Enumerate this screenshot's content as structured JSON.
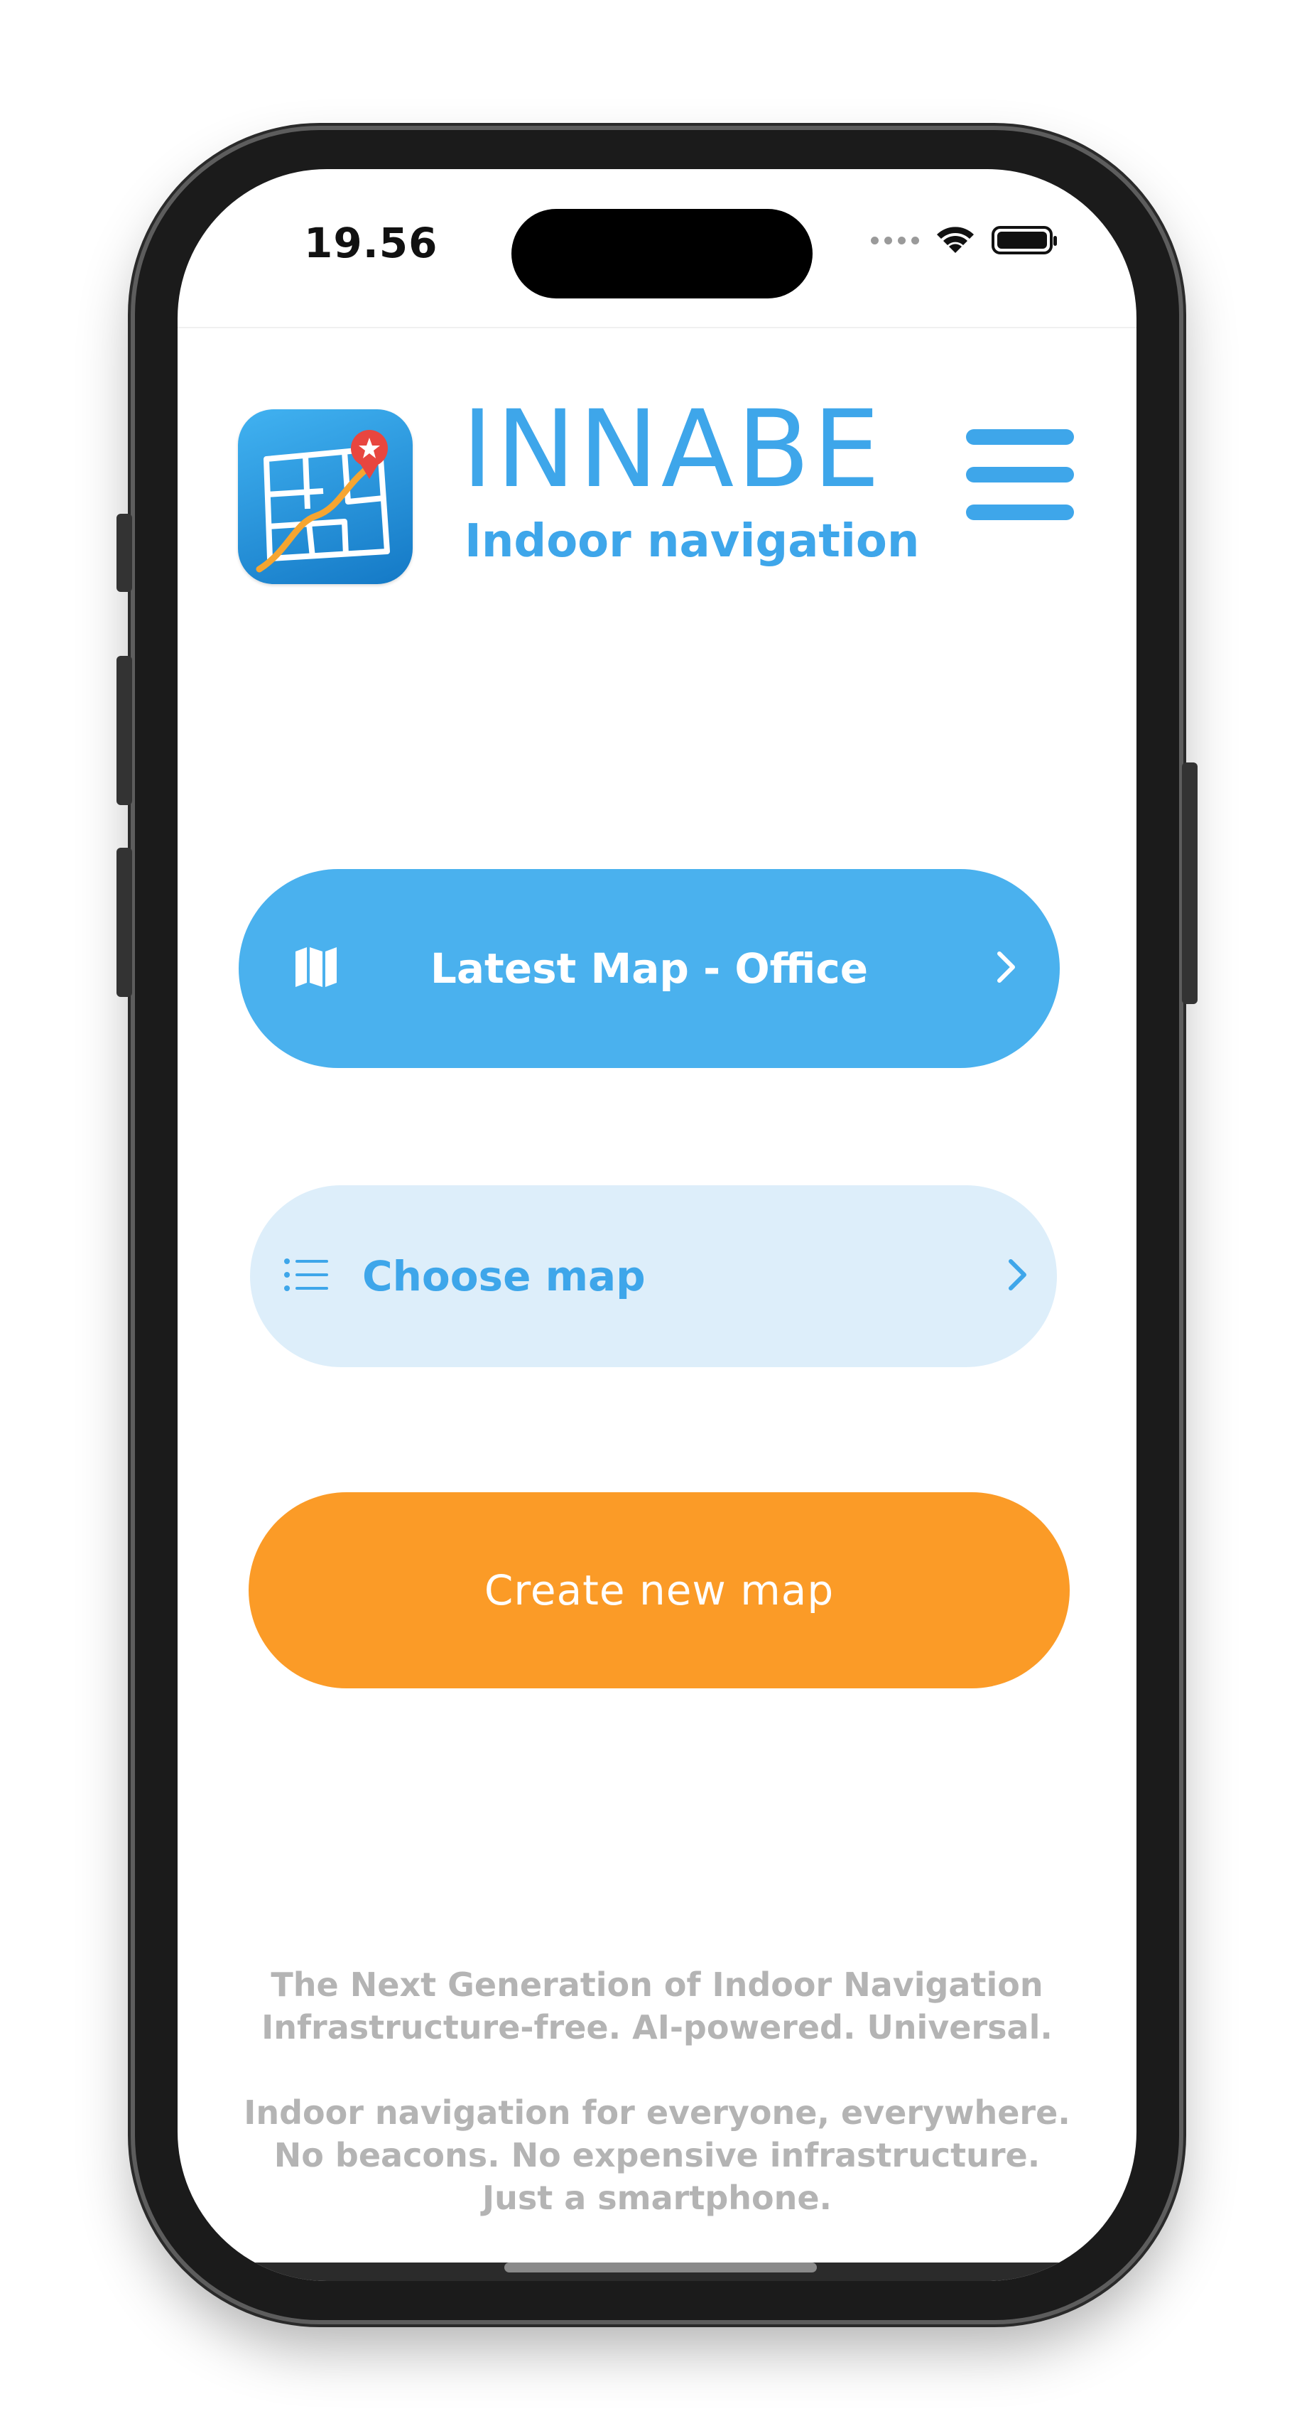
{
  "status_bar": {
    "time": "19.56"
  },
  "header": {
    "title": "INNABE",
    "subtitle": "Indoor navigation",
    "app_icon": "map-route-icon",
    "menu_icon": "hamburger-menu-icon"
  },
  "buttons": {
    "latest_map": {
      "label": "Latest Map - Office",
      "icon": "map-icon",
      "chevron": "chevron-right-icon"
    },
    "choose_map": {
      "label": "Choose map",
      "icon": "list-icon",
      "chevron": "chevron-right-icon"
    },
    "create_map": {
      "label": "Create new map"
    }
  },
  "footer": {
    "line1": "The Next Generation of Indoor Navigation",
    "line2": "Infrastructure-free. AI-powered. Universal.",
    "line3": "Indoor navigation for everyone, everywhere.",
    "line4": "No beacons. No expensive infrastructure.",
    "line5": "Just a smartphone."
  },
  "colors": {
    "brand_blue": "#3ea6ea",
    "primary_button": "#4ab1ee",
    "secondary_button": "#ddeefa",
    "accent_orange": "#fb9b27",
    "footer_text": "#b4b4b4"
  }
}
